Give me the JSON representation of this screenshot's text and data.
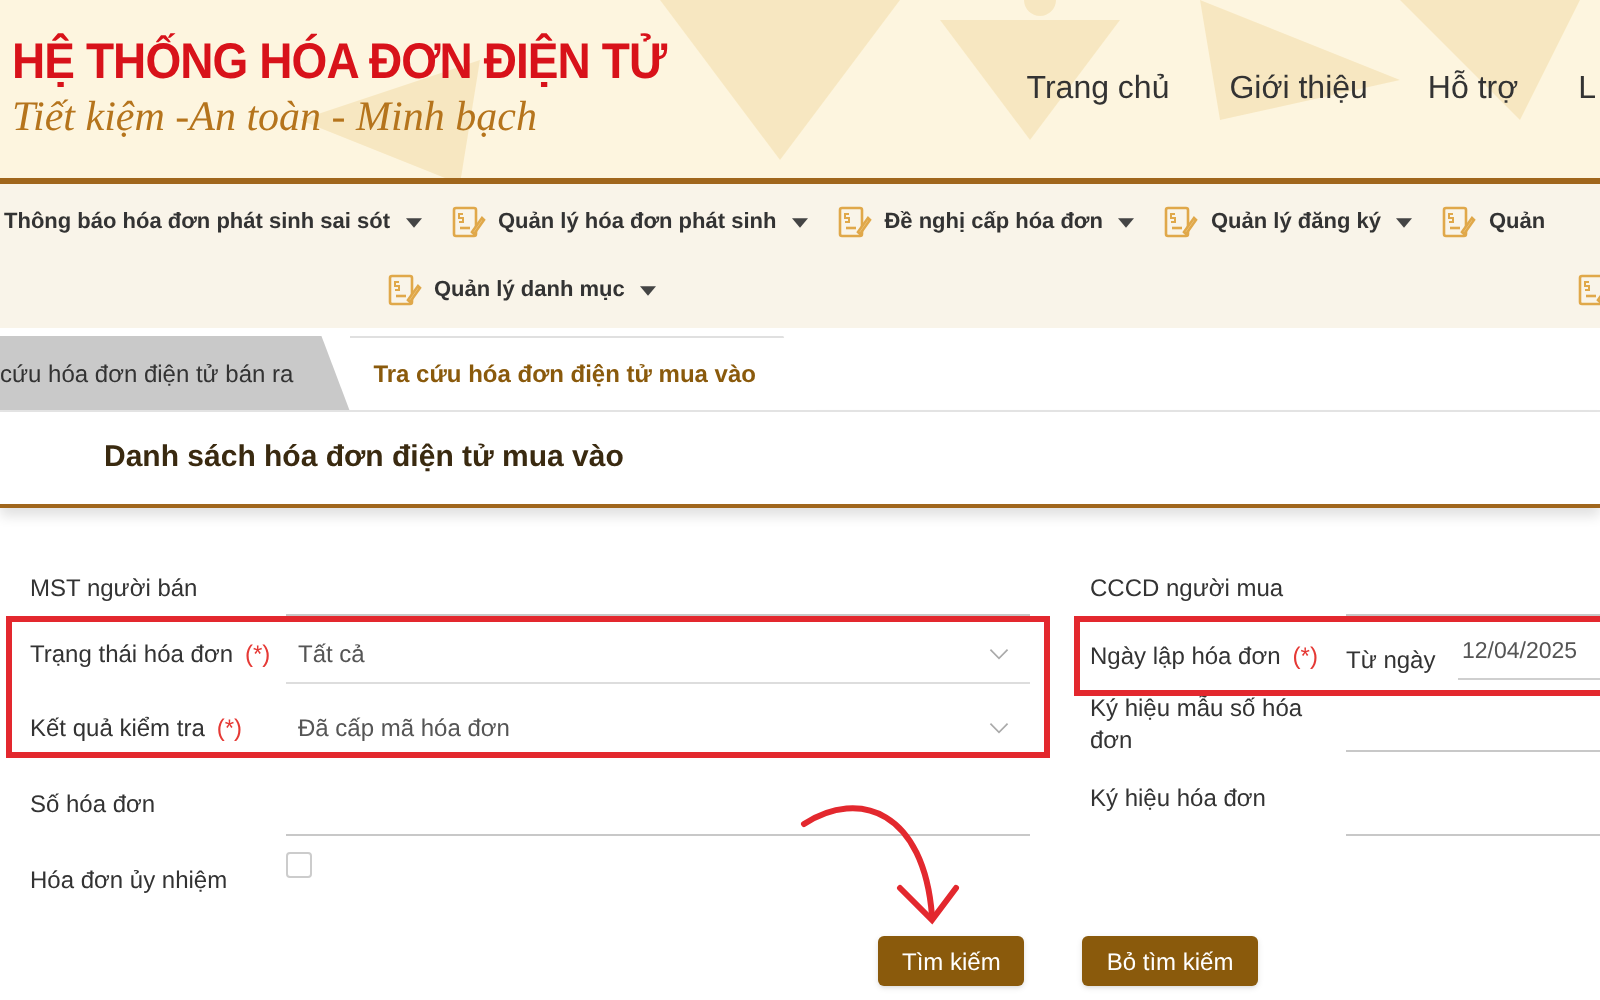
{
  "header": {
    "title": "HỆ THỐNG HÓA ĐƠN ĐIỆN TỬ",
    "slogan": "Tiết kiệm -An toàn - Minh bạch",
    "nav": [
      "Trang chủ",
      "Giới thiệu",
      "Hỗ trợ",
      "L"
    ]
  },
  "menu": [
    [
      {
        "label": "Thông báo hóa đơn phát sinh sai sót",
        "icon": false,
        "caret": true
      },
      {
        "label": "Quản lý hóa đơn phát sinh",
        "icon": true,
        "caret": true
      },
      {
        "label": "Đề nghị cấp hóa đơn",
        "icon": true,
        "caret": true
      },
      {
        "label": "Quản lý đăng ký",
        "icon": true,
        "caret": true
      },
      {
        "label": "Quản",
        "icon": true,
        "caret": false
      }
    ],
    [
      {
        "label": "Quản lý danh mục",
        "icon": true,
        "caret": true
      },
      {
        "icon": true,
        "caret": false
      }
    ]
  ],
  "tabs": [
    {
      "label": "cứu hóa đơn điện tử bán ra",
      "selected": false
    },
    {
      "label": "Tra cứu hóa đơn điện tử mua vào",
      "selected": true
    }
  ],
  "panel_title": "Danh sách hóa đơn điện tử mua vào",
  "left_fields": [
    {
      "kind": "text",
      "label": "MST người bán",
      "required": false
    },
    {
      "kind": "select",
      "label": "Trạng thái hóa đơn",
      "required": true,
      "value": "Tất cả"
    },
    {
      "kind": "select",
      "label": "Kết quả kiểm tra",
      "required": true,
      "value": "Đã cấp mã hóa đơn"
    },
    {
      "kind": "text",
      "label": "Số hóa đơn",
      "required": false
    },
    {
      "kind": "checkbox",
      "label": "Hóa đơn ủy nhiệm",
      "checked": false
    }
  ],
  "right_fields": [
    {
      "kind": "text",
      "label": "CCCD người mua",
      "required": false
    },
    {
      "kind": "date",
      "label": "Ngày lập hóa đơn",
      "required": true,
      "sublabel": "Từ ngày",
      "value": "12/04/2025"
    },
    {
      "kind": "text",
      "label": "Ký hiệu mẫu số hóa đơn",
      "required": false
    },
    {
      "kind": "text",
      "label": "Ký hiệu hóa đơn",
      "required": false
    }
  ],
  "required_mark": "(*)",
  "buttons": [
    "Tìm kiếm",
    "Bỏ tìm kiếm"
  ]
}
